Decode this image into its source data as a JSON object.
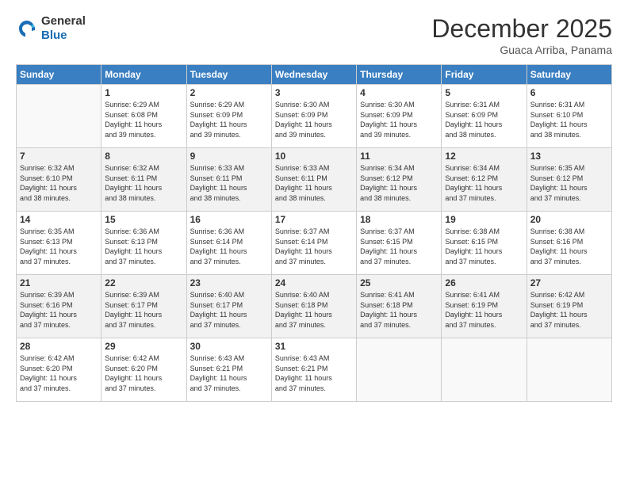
{
  "header": {
    "logo_general": "General",
    "logo_blue": "Blue",
    "month_year": "December 2025",
    "location": "Guaca Arriba, Panama"
  },
  "weekdays": [
    "Sunday",
    "Monday",
    "Tuesday",
    "Wednesday",
    "Thursday",
    "Friday",
    "Saturday"
  ],
  "weeks": [
    {
      "shaded": false,
      "days": [
        {
          "num": "",
          "detail": ""
        },
        {
          "num": "1",
          "detail": "Sunrise: 6:29 AM\nSunset: 6:08 PM\nDaylight: 11 hours\nand 39 minutes."
        },
        {
          "num": "2",
          "detail": "Sunrise: 6:29 AM\nSunset: 6:09 PM\nDaylight: 11 hours\nand 39 minutes."
        },
        {
          "num": "3",
          "detail": "Sunrise: 6:30 AM\nSunset: 6:09 PM\nDaylight: 11 hours\nand 39 minutes."
        },
        {
          "num": "4",
          "detail": "Sunrise: 6:30 AM\nSunset: 6:09 PM\nDaylight: 11 hours\nand 39 minutes."
        },
        {
          "num": "5",
          "detail": "Sunrise: 6:31 AM\nSunset: 6:09 PM\nDaylight: 11 hours\nand 38 minutes."
        },
        {
          "num": "6",
          "detail": "Sunrise: 6:31 AM\nSunset: 6:10 PM\nDaylight: 11 hours\nand 38 minutes."
        }
      ]
    },
    {
      "shaded": true,
      "days": [
        {
          "num": "7",
          "detail": "Sunrise: 6:32 AM\nSunset: 6:10 PM\nDaylight: 11 hours\nand 38 minutes."
        },
        {
          "num": "8",
          "detail": "Sunrise: 6:32 AM\nSunset: 6:11 PM\nDaylight: 11 hours\nand 38 minutes."
        },
        {
          "num": "9",
          "detail": "Sunrise: 6:33 AM\nSunset: 6:11 PM\nDaylight: 11 hours\nand 38 minutes."
        },
        {
          "num": "10",
          "detail": "Sunrise: 6:33 AM\nSunset: 6:11 PM\nDaylight: 11 hours\nand 38 minutes."
        },
        {
          "num": "11",
          "detail": "Sunrise: 6:34 AM\nSunset: 6:12 PM\nDaylight: 11 hours\nand 38 minutes."
        },
        {
          "num": "12",
          "detail": "Sunrise: 6:34 AM\nSunset: 6:12 PM\nDaylight: 11 hours\nand 37 minutes."
        },
        {
          "num": "13",
          "detail": "Sunrise: 6:35 AM\nSunset: 6:12 PM\nDaylight: 11 hours\nand 37 minutes."
        }
      ]
    },
    {
      "shaded": false,
      "days": [
        {
          "num": "14",
          "detail": "Sunrise: 6:35 AM\nSunset: 6:13 PM\nDaylight: 11 hours\nand 37 minutes."
        },
        {
          "num": "15",
          "detail": "Sunrise: 6:36 AM\nSunset: 6:13 PM\nDaylight: 11 hours\nand 37 minutes."
        },
        {
          "num": "16",
          "detail": "Sunrise: 6:36 AM\nSunset: 6:14 PM\nDaylight: 11 hours\nand 37 minutes."
        },
        {
          "num": "17",
          "detail": "Sunrise: 6:37 AM\nSunset: 6:14 PM\nDaylight: 11 hours\nand 37 minutes."
        },
        {
          "num": "18",
          "detail": "Sunrise: 6:37 AM\nSunset: 6:15 PM\nDaylight: 11 hours\nand 37 minutes."
        },
        {
          "num": "19",
          "detail": "Sunrise: 6:38 AM\nSunset: 6:15 PM\nDaylight: 11 hours\nand 37 minutes."
        },
        {
          "num": "20",
          "detail": "Sunrise: 6:38 AM\nSunset: 6:16 PM\nDaylight: 11 hours\nand 37 minutes."
        }
      ]
    },
    {
      "shaded": true,
      "days": [
        {
          "num": "21",
          "detail": "Sunrise: 6:39 AM\nSunset: 6:16 PM\nDaylight: 11 hours\nand 37 minutes."
        },
        {
          "num": "22",
          "detail": "Sunrise: 6:39 AM\nSunset: 6:17 PM\nDaylight: 11 hours\nand 37 minutes."
        },
        {
          "num": "23",
          "detail": "Sunrise: 6:40 AM\nSunset: 6:17 PM\nDaylight: 11 hours\nand 37 minutes."
        },
        {
          "num": "24",
          "detail": "Sunrise: 6:40 AM\nSunset: 6:18 PM\nDaylight: 11 hours\nand 37 minutes."
        },
        {
          "num": "25",
          "detail": "Sunrise: 6:41 AM\nSunset: 6:18 PM\nDaylight: 11 hours\nand 37 minutes."
        },
        {
          "num": "26",
          "detail": "Sunrise: 6:41 AM\nSunset: 6:19 PM\nDaylight: 11 hours\nand 37 minutes."
        },
        {
          "num": "27",
          "detail": "Sunrise: 6:42 AM\nSunset: 6:19 PM\nDaylight: 11 hours\nand 37 minutes."
        }
      ]
    },
    {
      "shaded": false,
      "days": [
        {
          "num": "28",
          "detail": "Sunrise: 6:42 AM\nSunset: 6:20 PM\nDaylight: 11 hours\nand 37 minutes."
        },
        {
          "num": "29",
          "detail": "Sunrise: 6:42 AM\nSunset: 6:20 PM\nDaylight: 11 hours\nand 37 minutes."
        },
        {
          "num": "30",
          "detail": "Sunrise: 6:43 AM\nSunset: 6:21 PM\nDaylight: 11 hours\nand 37 minutes."
        },
        {
          "num": "31",
          "detail": "Sunrise: 6:43 AM\nSunset: 6:21 PM\nDaylight: 11 hours\nand 37 minutes."
        },
        {
          "num": "",
          "detail": ""
        },
        {
          "num": "",
          "detail": ""
        },
        {
          "num": "",
          "detail": ""
        }
      ]
    }
  ]
}
